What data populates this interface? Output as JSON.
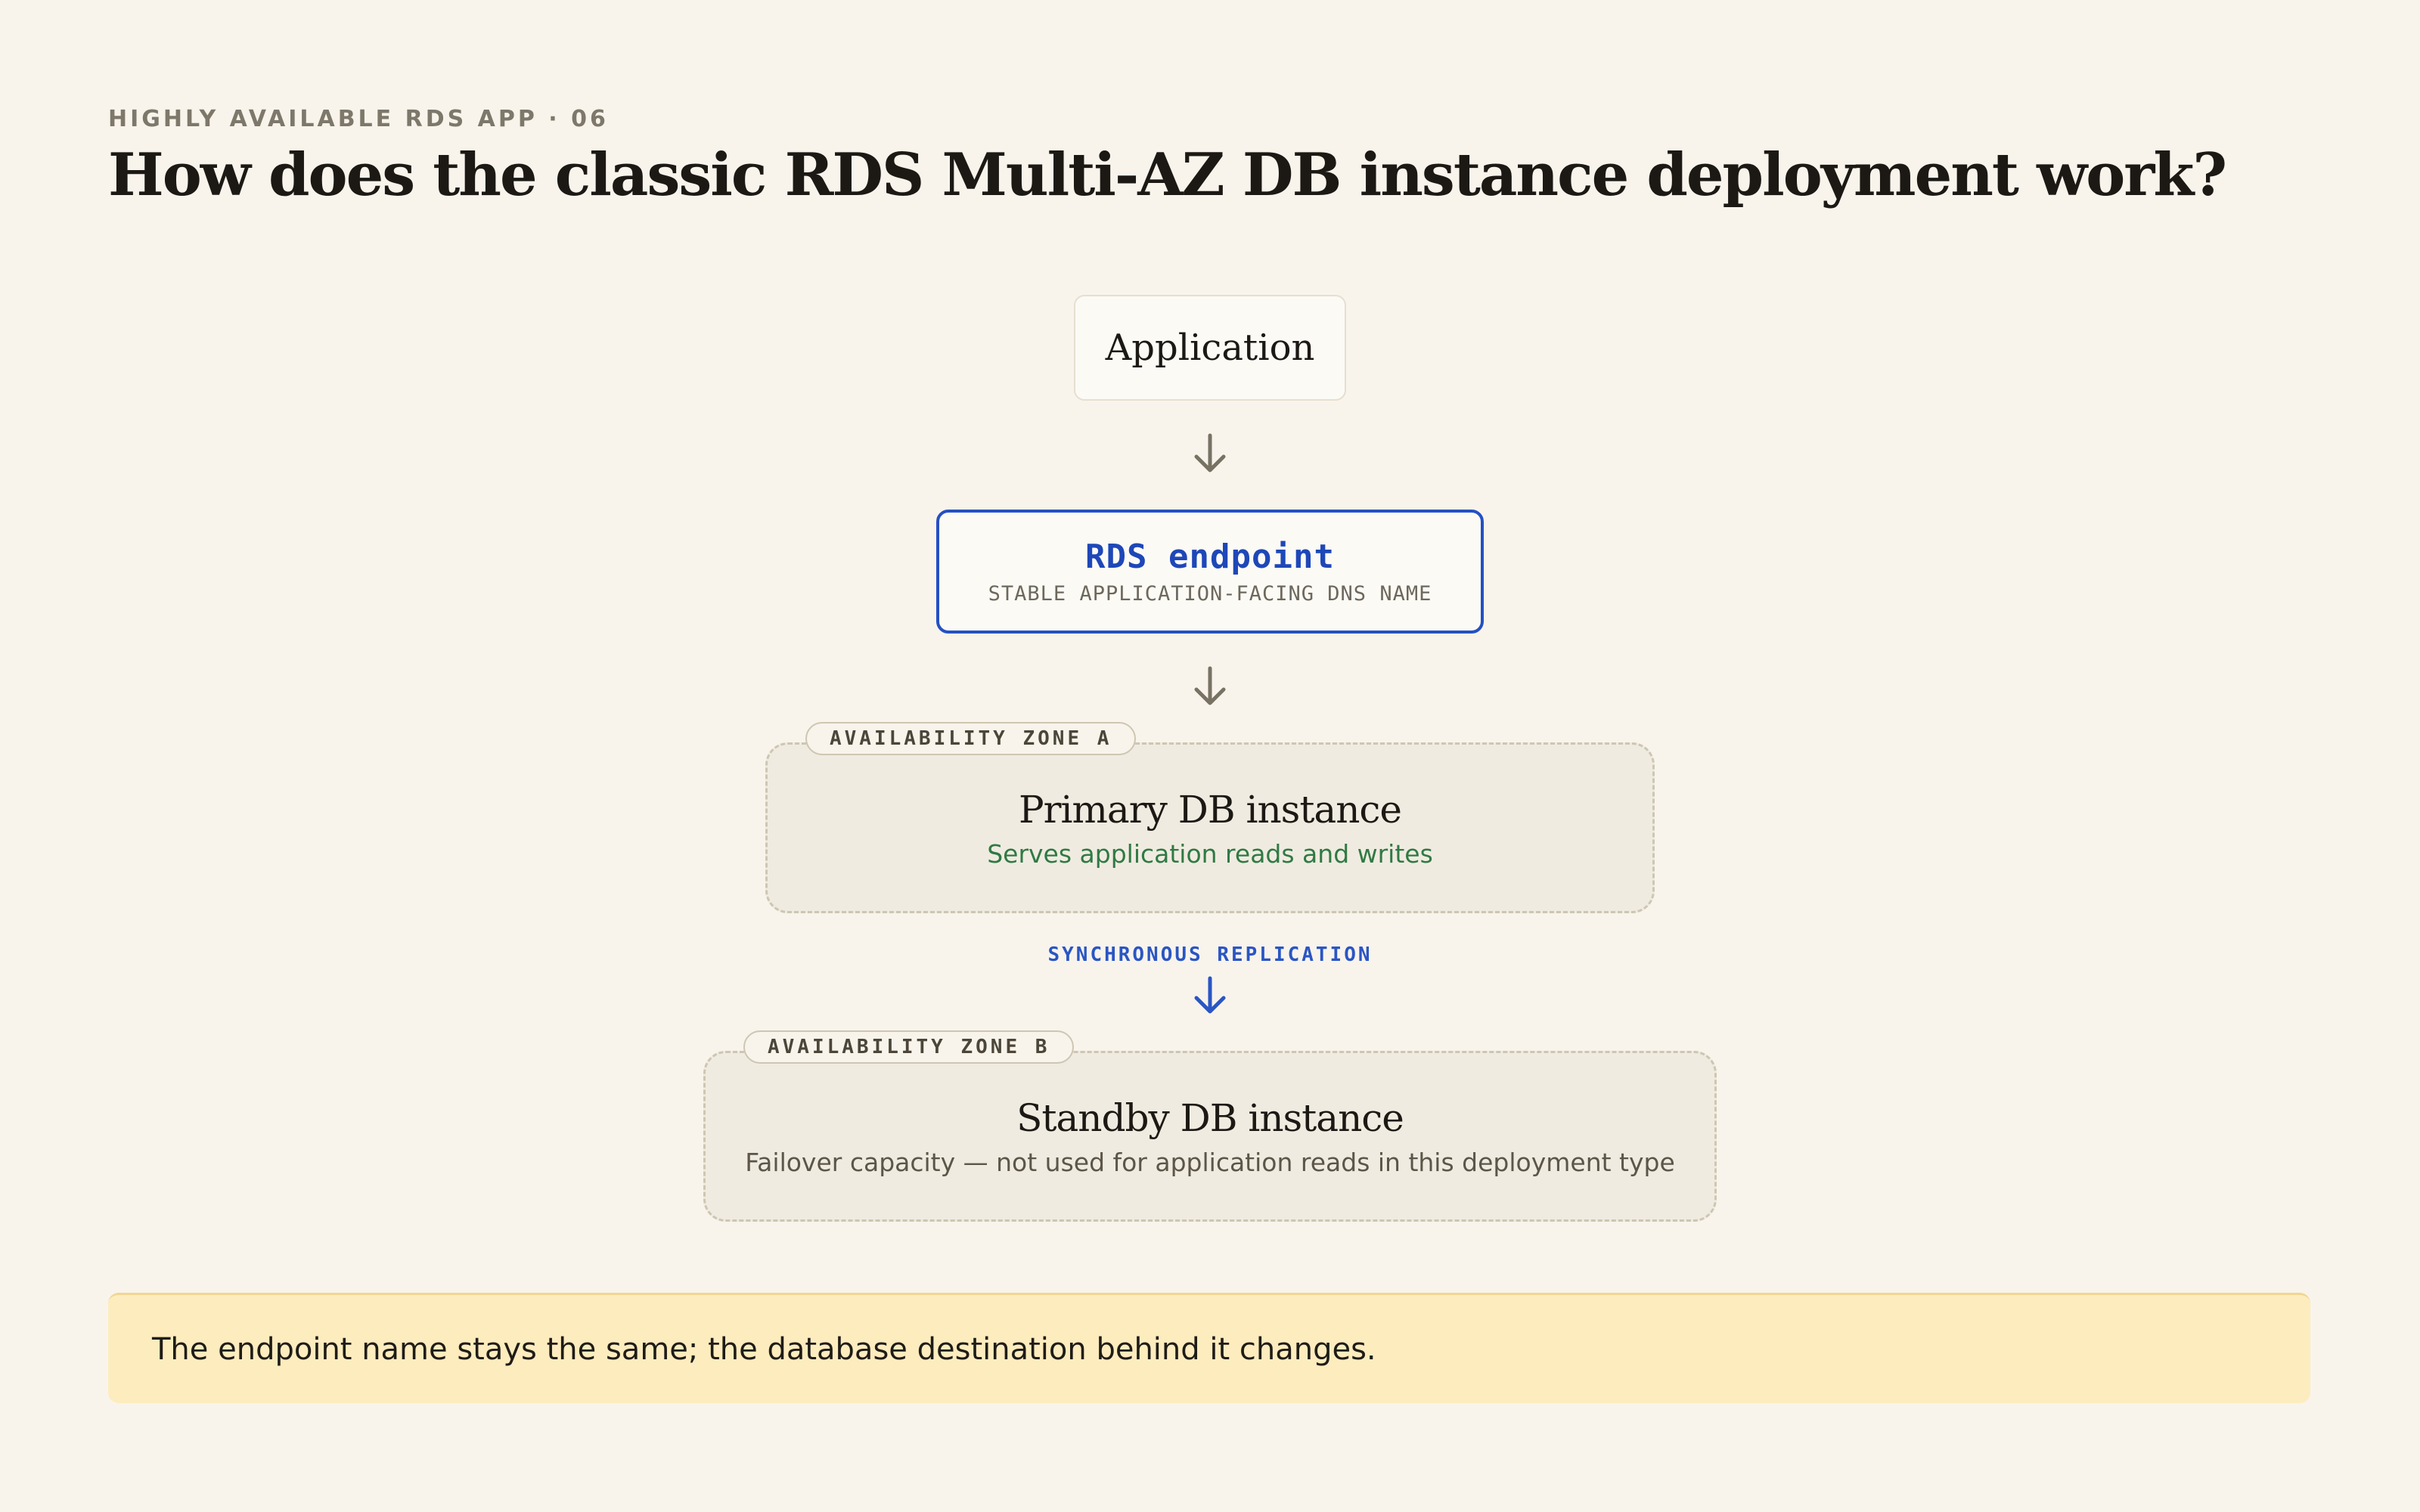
{
  "header": {
    "eyebrow": "HIGHLY AVAILABLE RDS APP · 06",
    "title": "How does the classic RDS Multi-AZ DB instance deployment work?"
  },
  "diagram": {
    "application": {
      "label": "Application"
    },
    "endpoint": {
      "label": "RDS endpoint",
      "sublabel": "STABLE APPLICATION-FACING DNS NAME"
    },
    "zone_a": {
      "tag": "AVAILABILITY ZONE A",
      "title": "Primary DB instance",
      "description": "Serves application reads and writes"
    },
    "replication": {
      "label": "SYNCHRONOUS REPLICATION"
    },
    "zone_b": {
      "tag": "AVAILABILITY ZONE B",
      "title": "Standby DB instance",
      "description": "Failover capacity — not used for application reads in this deployment type"
    }
  },
  "note": {
    "text": "The endpoint name stays the same; the database destination behind it changes."
  },
  "colors": {
    "background": "#f8f4ec",
    "accent_blue": "#2550c4",
    "primary_green": "#2f7a44",
    "note_yellow": "#fdecbe",
    "arrow_gray": "#777262"
  },
  "icons": {
    "flow_arrow": "arrow-down-icon"
  }
}
